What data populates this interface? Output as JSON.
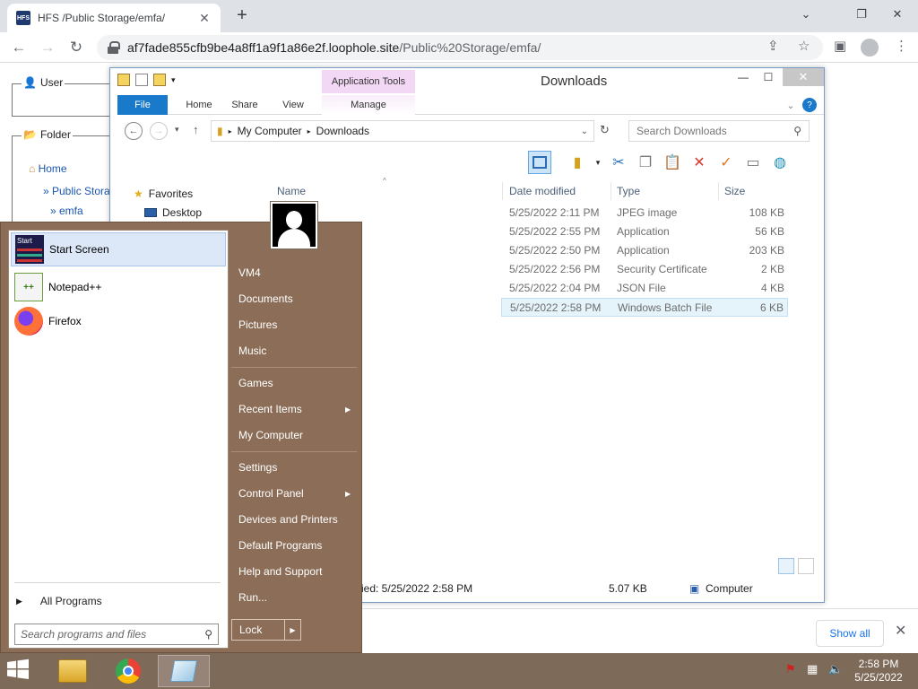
{
  "browser": {
    "tab_title": "HFS /Public Storage/emfa/",
    "favicon_text": "HFS",
    "url_host": "af7fade855cfb9be4a8ff1a9f1a86e2f.loophole.site",
    "url_path": "/Public%20Storage/emfa/"
  },
  "hfs": {
    "user_legend": "User",
    "folder_legend": "Folder",
    "tree": [
      "Home",
      "» Public Stora",
      "» emfa"
    ]
  },
  "download_bar": {
    "show_all": "Show all"
  },
  "explorer": {
    "title": "Downloads",
    "app_tools": "Application Tools",
    "ribbon_tabs": [
      "File",
      "Home",
      "Share",
      "View",
      "Manage"
    ],
    "breadcrumb": [
      "My Computer",
      "Downloads"
    ],
    "search_placeholder": "Search Downloads",
    "favorites_label": "Favorites",
    "nav_items": [
      "Desktop"
    ],
    "columns": [
      "Name",
      "Date modified",
      "Type",
      "Size"
    ],
    "files": [
      {
        "date": "5/25/2022 2:11 PM",
        "type": "JPEG image",
        "size": "108 KB"
      },
      {
        "date": "5/25/2022 2:55 PM",
        "type": "Application",
        "size": "56 KB"
      },
      {
        "date": "5/25/2022 2:50 PM",
        "type": "Application",
        "size": "203 KB"
      },
      {
        "date": "5/25/2022 2:56 PM",
        "type": "Security Certificate",
        "size": "2 KB"
      },
      {
        "date": "5/25/2022 2:04 PM",
        "type": "JSON File",
        "size": "4 KB"
      },
      {
        "date": "5/25/2022 2:58 PM",
        "type": "Windows Batch File",
        "size": "6 KB"
      }
    ],
    "status_modified": "ied: 5/25/2022 2:58 PM",
    "status_size": "5.07 KB",
    "status_location": "Computer"
  },
  "start_menu": {
    "programs": [
      "Start Screen",
      "Notepad++",
      "Firefox"
    ],
    "start_tile_text": "Start",
    "all_programs": "All Programs",
    "search_placeholder": "Search programs and files",
    "right_items": [
      "VM4",
      "Documents",
      "Pictures",
      "Music",
      "Games",
      "Recent Items",
      "My Computer",
      "Settings",
      "Control Panel",
      "Devices and Printers",
      "Default Programs",
      "Help and Support",
      "Run..."
    ],
    "lock_label": "Lock"
  },
  "taskbar": {
    "time": "2:58 PM",
    "date": "5/25/2022"
  },
  "colors": {
    "start_menu_bg": "#8c6e58",
    "taskbar_bg": "#7e6a59",
    "ribbon_file": "#1979ca",
    "app_tools": "#f3d8f5"
  }
}
